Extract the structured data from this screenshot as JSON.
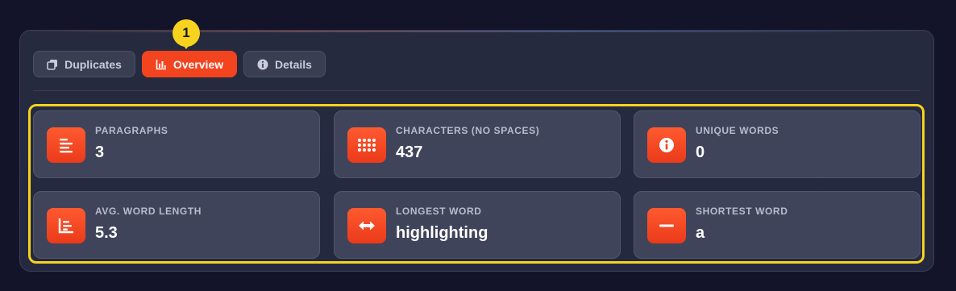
{
  "tabs": [
    {
      "label": "Duplicates",
      "icon": "copy-icon",
      "active": false
    },
    {
      "label": "Overview",
      "icon": "bar-chart-icon",
      "active": true
    },
    {
      "label": "Details",
      "icon": "info-icon",
      "active": false
    }
  ],
  "badge": "1",
  "stats": [
    {
      "label": "PARAGRAPHS",
      "value": "3",
      "icon": "align-left-icon"
    },
    {
      "label": "CHARACTERS (NO SPACES)",
      "value": "437",
      "icon": "grid-dots-icon"
    },
    {
      "label": "UNIQUE WORDS",
      "value": "0",
      "icon": "info-icon"
    },
    {
      "label": "AVG. WORD LENGTH",
      "value": "5.3",
      "icon": "bar-chart-icon"
    },
    {
      "label": "LONGEST WORD",
      "value": "highlighting",
      "icon": "arrows-horizontal-icon"
    },
    {
      "label": "SHORTEST WORD",
      "value": "a",
      "icon": "minus-icon"
    }
  ],
  "colors": {
    "accent": "#f2441f",
    "highlight": "#f7d21e",
    "background": "#13142a"
  }
}
